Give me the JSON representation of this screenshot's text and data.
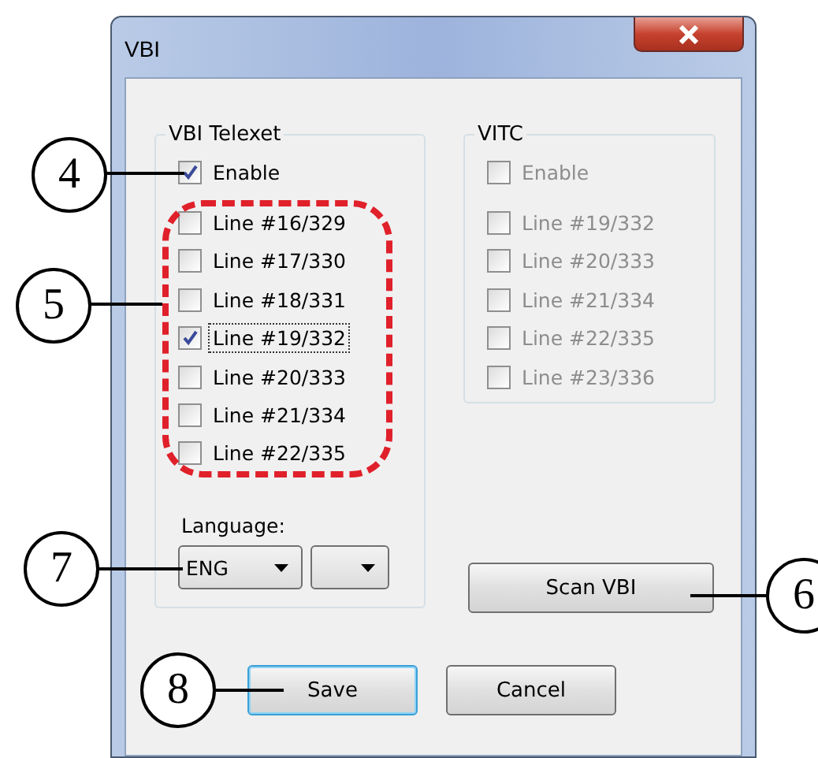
{
  "window": {
    "title": "VBI"
  },
  "telexet": {
    "title": "VBI Telexet",
    "enable": {
      "label": "Enable",
      "checked": true
    },
    "lines": [
      {
        "label": "Line #16/329",
        "checked": false,
        "focused": false
      },
      {
        "label": "Line #17/330",
        "checked": false,
        "focused": false
      },
      {
        "label": "Line #18/331",
        "checked": false,
        "focused": false
      },
      {
        "label": "Line #19/332",
        "checked": true,
        "focused": true
      },
      {
        "label": "Line #20/333",
        "checked": false,
        "focused": false
      },
      {
        "label": "Line #21/334",
        "checked": false,
        "focused": false
      },
      {
        "label": "Line #22/335",
        "checked": false,
        "focused": false
      }
    ],
    "language_label": "Language:",
    "combos": [
      {
        "kind": "dropdown",
        "value": "ENG"
      },
      {
        "kind": "dropdown"
      }
    ]
  },
  "vitc": {
    "title": "VITC",
    "disabled": true,
    "enable": {
      "label": "Enable",
      "checked": false
    },
    "lines": [
      {
        "label": "Line #19/332",
        "checked": false
      },
      {
        "label": "Line #20/333",
        "checked": false
      },
      {
        "label": "Line #21/334",
        "checked": false
      },
      {
        "label": "Line #22/335",
        "checked": false
      },
      {
        "label": "Line #23/336",
        "checked": false
      }
    ]
  },
  "scan_button": "Scan VBI",
  "buttons": [
    {
      "label": "Save",
      "default": true
    },
    {
      "label": "Cancel",
      "default": false
    }
  ],
  "callouts": [
    {
      "number": "4"
    },
    {
      "number": "5"
    },
    {
      "number": "7"
    },
    {
      "number": "6"
    },
    {
      "number": "8"
    }
  ]
}
